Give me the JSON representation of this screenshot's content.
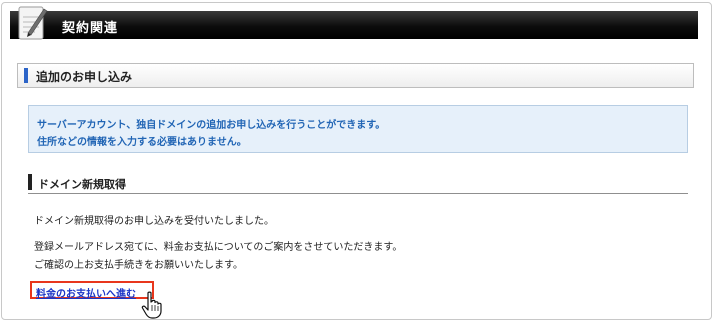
{
  "header": {
    "title": "契約関連",
    "logo_icon": "notebook-pen-icon"
  },
  "section": {
    "title": "追加のお申し込み"
  },
  "info": {
    "line1": "サーバーアカウント、独自ドメインの追加お申し込みを行うことができます。",
    "line2": "住所などの情報を入力する必要はありません。"
  },
  "domain_section": {
    "title": "ドメイン新規取得",
    "paragraph1": "ドメイン新規取得のお申し込みを受付いたしました。",
    "paragraph2_line1": "登録メールアドレス宛てに、料金お支払についてのご案内をさせていただきます。",
    "paragraph2_line2": "ご確認の上お支払手続きをお願いいたします。"
  },
  "link": {
    "label": "料金のお支払いへ進む",
    "highlight_color": "#e8361c",
    "cursor_icon": "hand-pointer-icon"
  },
  "colors": {
    "accent": "#2c64c8",
    "info_text": "#2165b5",
    "info_bg": "#e6f0fa",
    "link": "#1a35c6"
  }
}
